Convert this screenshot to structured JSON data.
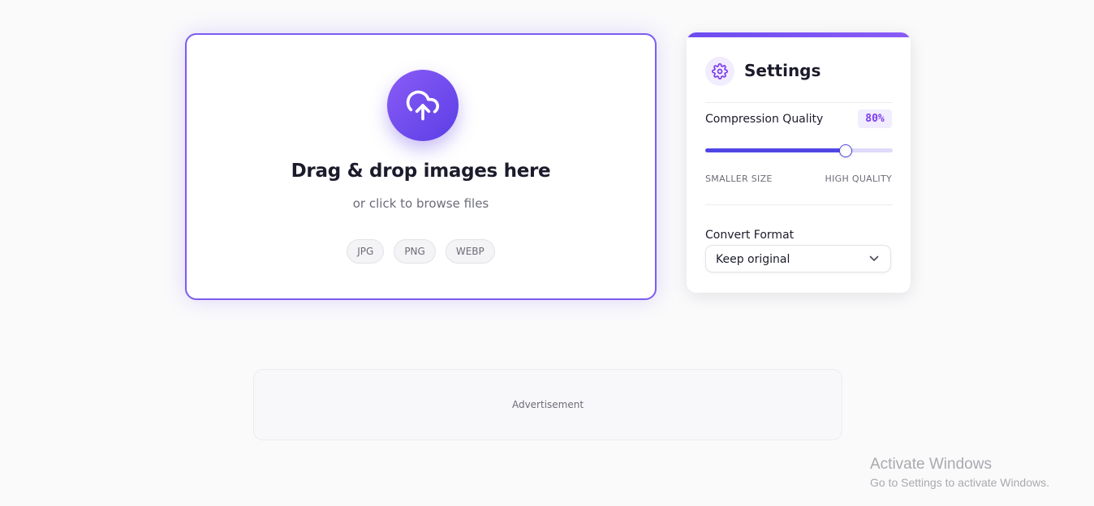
{
  "upload": {
    "icon": "cloud-upload-icon",
    "title": "Drag & drop images here",
    "subtitle": "or click to browse files",
    "formats": [
      "JPG",
      "PNG",
      "WEBP"
    ]
  },
  "settings": {
    "icon": "gear-icon",
    "title": "Settings",
    "compression": {
      "label": "Compression Quality",
      "value_label": "80%",
      "value": 0.75,
      "min_label": "SMALLER SIZE",
      "max_label": "HIGH QUALITY"
    },
    "convert": {
      "label": "Convert Format",
      "selected": "Keep original"
    }
  },
  "ad": {
    "label": "Advertisement"
  },
  "watermark": {
    "title": "Activate Windows",
    "subtitle": "Go to Settings to activate Windows."
  },
  "colors": {
    "accent": "#7c5cf0",
    "accent_dark": "#4f46e5",
    "background": "#fafafb"
  }
}
